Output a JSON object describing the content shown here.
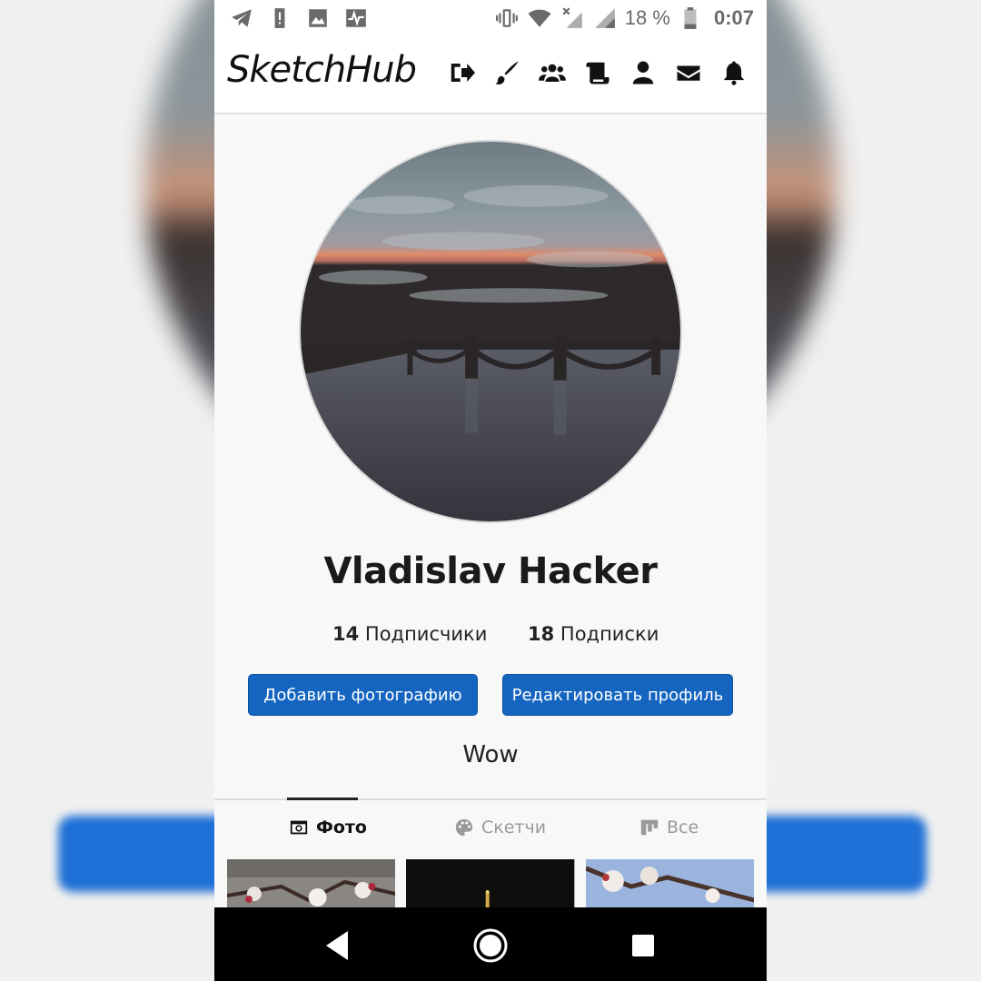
{
  "status_bar": {
    "battery": "18 %",
    "time": "0:07",
    "left_icons": [
      "telegram-icon",
      "alert-icon",
      "image-icon",
      "activity-icon"
    ],
    "right_icons": [
      "vibrate-icon",
      "wifi-icon",
      "signal-x-icon",
      "signal-icon",
      "battery-icon"
    ]
  },
  "header": {
    "logo": "SketchHub",
    "nav_icons": [
      "sign-out-icon",
      "brush-icon",
      "users-icon",
      "scroll-icon",
      "user-icon",
      "envelope-icon",
      "bell-icon"
    ]
  },
  "profile": {
    "name": "Vladislav Hacker",
    "followers_count": "14",
    "followers_label": "Подписчики",
    "following_count": "18",
    "following_label": "Подписки",
    "add_photo_label": "Добавить фотографию",
    "edit_profile_label": "Редактировать профиль",
    "bio": "Wow"
  },
  "tabs": [
    {
      "label": "Фото",
      "icon": "camera-icon",
      "active": true
    },
    {
      "label": "Скетчи",
      "icon": "palette-icon",
      "active": false
    },
    {
      "label": "Все",
      "icon": "grid-icon",
      "active": false
    }
  ],
  "colors": {
    "primary_button": "#1565c0",
    "header_bg": "#ffffff",
    "page_bg": "#f8f8f8",
    "nav_bar": "#000000"
  }
}
